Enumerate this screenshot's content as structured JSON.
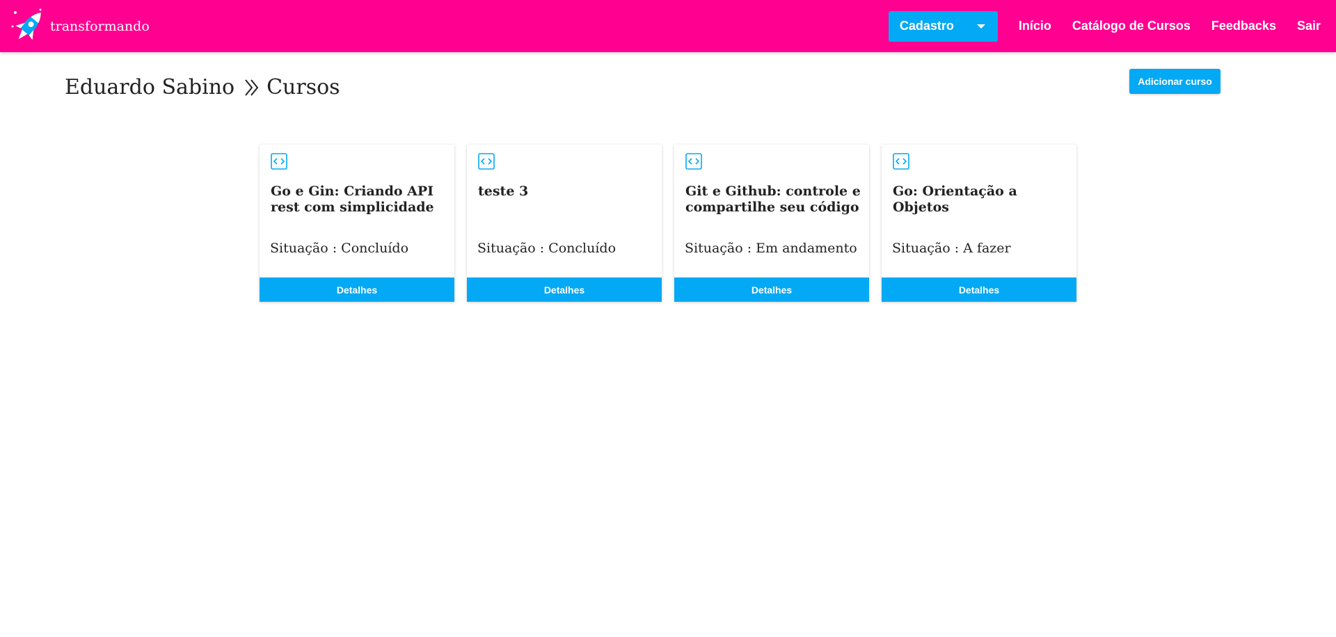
{
  "brand": {
    "name": "transformando",
    "logo_icon": "rocket-icon"
  },
  "nav": {
    "dropdown_label": "Cadastro",
    "links": [
      "Início",
      "Catálogo de Cursos",
      "Feedbacks",
      "Sair"
    ]
  },
  "breadcrumb": {
    "user": "Eduardo Sabino",
    "section": "Cursos",
    "separator_icon": "double-chevron-right-icon"
  },
  "actions": {
    "add_course": "Adicionar curso"
  },
  "courses": [
    {
      "icon": "code-icon",
      "title": "Go e Gin: Criando API rest com simplicidade",
      "status": "Situação : Concluído",
      "button": "Detalhes"
    },
    {
      "icon": "code-icon",
      "title": "teste 3",
      "status": "Situação : Concluído",
      "button": "Detalhes"
    },
    {
      "icon": "code-icon",
      "title": "Git e Github: controle e compartilhe seu código",
      "status": "Situação : Em andamento",
      "button": "Detalhes"
    },
    {
      "icon": "code-icon",
      "title": "Go: Orientação a Objetos",
      "status": "Situação : A fazer",
      "button": "Detalhes"
    }
  ],
  "colors": {
    "topbar": "#ff0090",
    "accent": "#03a9f4",
    "text": "#222222"
  }
}
